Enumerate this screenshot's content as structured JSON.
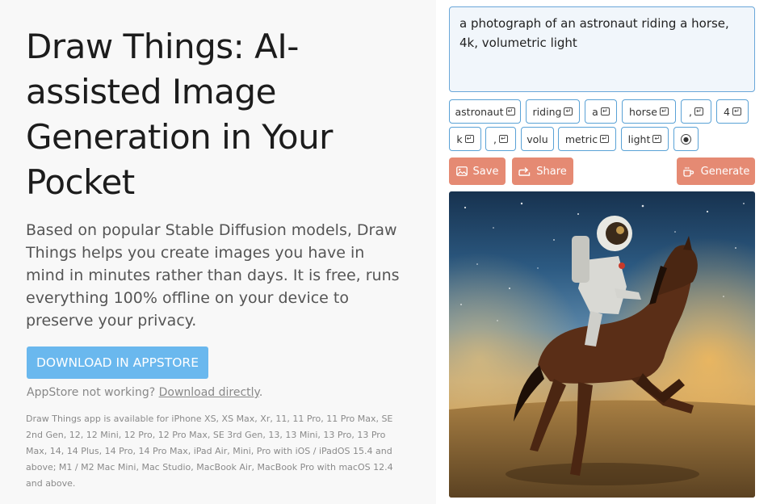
{
  "hero": {
    "title": "Draw Things: AI-assisted Image Generation in Your Pocket",
    "description": "Based on popular Stable Diffusion models, Draw Things helps you create images you have in mind in minutes rather than days. It is free, runs everything 100% offline on your device to preserve your privacy.",
    "download_label": "DOWNLOAD IN APPSTORE",
    "not_working_text": "AppStore not working?",
    "direct_link_label": "Download directly",
    "period": ".",
    "compatibility": "Draw Things app is available for iPhone XS, XS Max, Xr, 11, 11 Pro, 11 Pro Max, SE 2nd Gen, 12, 12 Mini, 12 Pro, 12 Pro Max, SE 3rd Gen, 13, 13 Mini, 13 Pro, 13 Pro Max, 14, 14 Plus, 14 Pro, 14 Pro Max, iPad Air, Mini, Pro with iOS / iPadOS 15.4 and above; M1 / M2 Mac Mini, Mac Studio, MacBook Air, MacBook Pro with macOS 12.4 and above."
  },
  "demo": {
    "prompt": "a photograph of an astronaut riding a horse, 4k, volumetric light",
    "tokens": [
      "astronaut",
      "riding",
      "a",
      "horse",
      ",",
      "4",
      "k",
      ",",
      "volu",
      "metric",
      "light"
    ],
    "token_icon": "return-key-icon",
    "end_icon": "circle-dot-icon",
    "save_label": "Save",
    "share_label": "Share",
    "generate_label": "Generate",
    "image_alt": "astronaut riding a horse"
  },
  "colors": {
    "download_button": "#6ab8ee",
    "action_button": "#e58a73",
    "token_border": "#5aa2d6",
    "left_background": "#f8f8f8"
  }
}
